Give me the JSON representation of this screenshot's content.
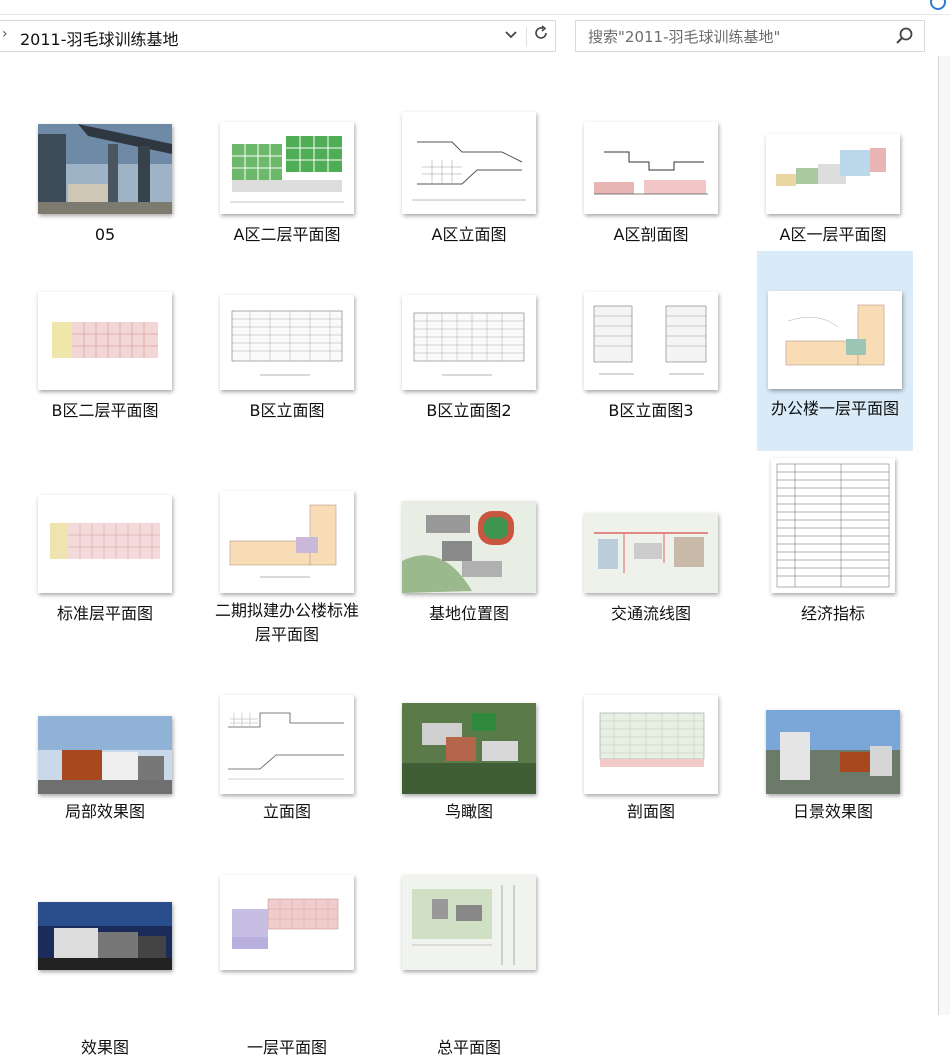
{
  "address_bar": {
    "path": "2011-羽毛球训练基地"
  },
  "search": {
    "placeholder": "搜索\"2011-羽毛球训练基地\""
  },
  "files": [
    {
      "name": "05"
    },
    {
      "name": "A区二层平面图"
    },
    {
      "name": "A区立面图"
    },
    {
      "name": "A区剖面图"
    },
    {
      "name": "A区一层平面图"
    },
    {
      "name": "B区二层平面图"
    },
    {
      "name": "B区立面图"
    },
    {
      "name": "B区立面图2"
    },
    {
      "name": "B区立面图3"
    },
    {
      "name": "办公楼一层平面图",
      "selected": true
    },
    {
      "name": "标准层平面图"
    },
    {
      "name": "二期拟建办公楼标准层平面图"
    },
    {
      "name": "基地位置图"
    },
    {
      "name": "交通流线图"
    },
    {
      "name": "经济指标"
    },
    {
      "name": "局部效果图"
    },
    {
      "name": "立面图"
    },
    {
      "name": "鸟瞰图"
    },
    {
      "name": "剖面图"
    },
    {
      "name": "日景效果图"
    },
    {
      "name": "效果图"
    },
    {
      "name": "一层平面图"
    },
    {
      "name": "总平面图"
    }
  ],
  "colors": {
    "selection": "#d9ebf9",
    "accent": "#2b7bd0"
  }
}
